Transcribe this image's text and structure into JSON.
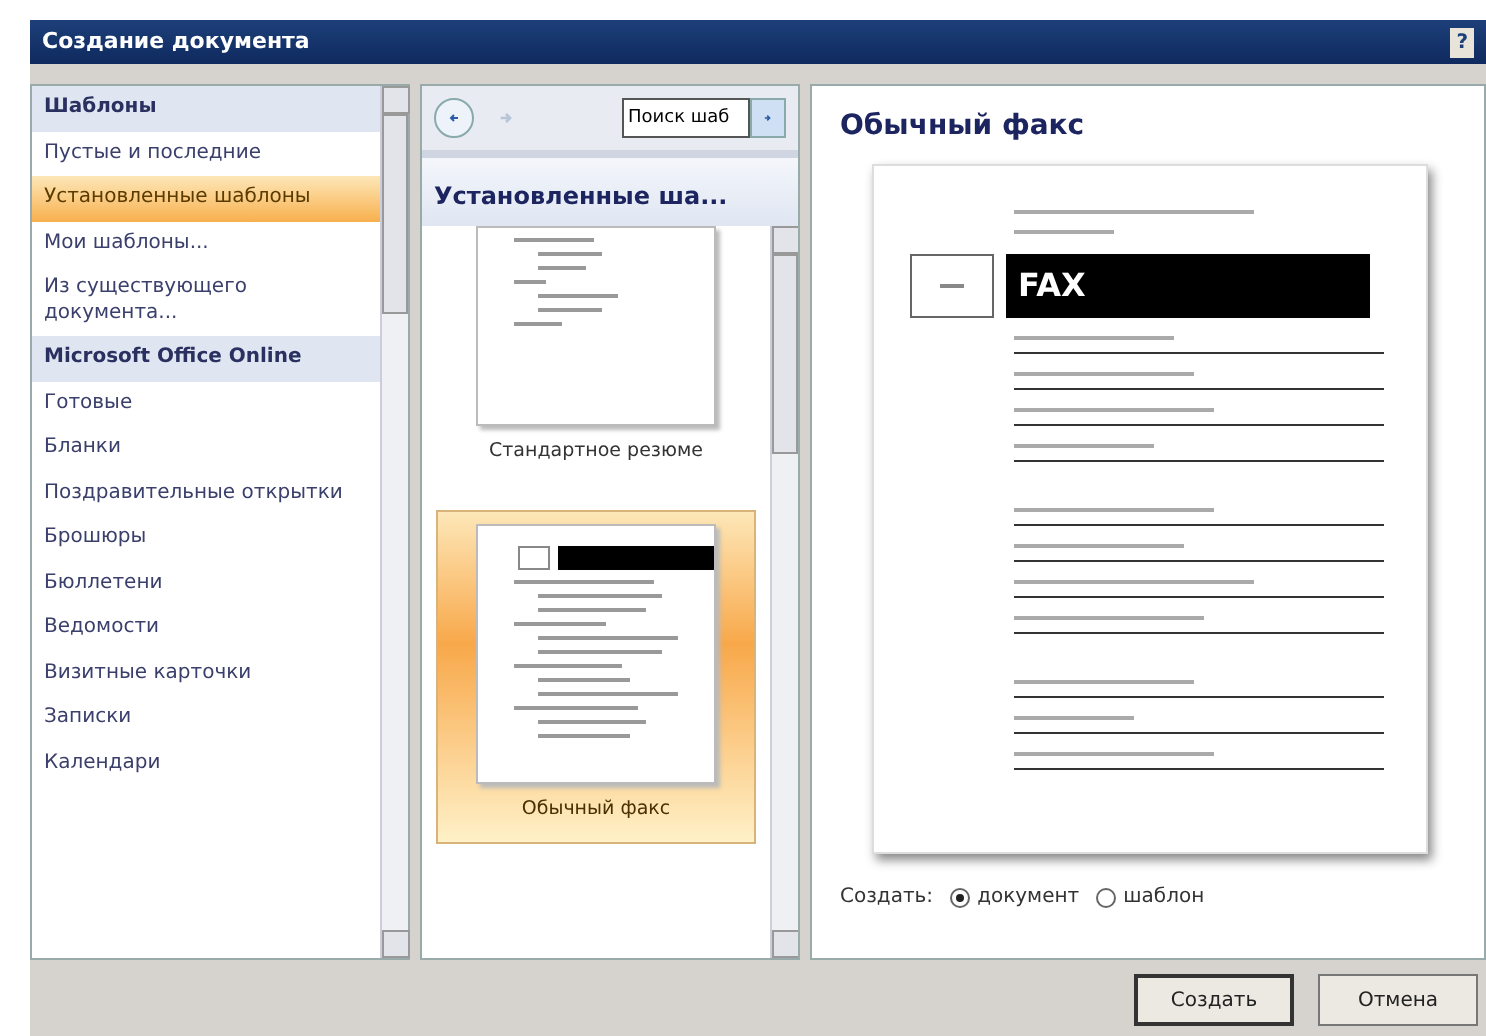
{
  "window": {
    "title": "Создание документа",
    "help": "?"
  },
  "sidebar": {
    "items": [
      {
        "kind": "header",
        "label": "Шаблоны",
        "selected": false
      },
      {
        "kind": "item",
        "label": "Пустые и последние",
        "selected": false
      },
      {
        "kind": "item",
        "label": "Установленные шаблоны",
        "selected": true
      },
      {
        "kind": "item",
        "label": "Мои шаблоны...",
        "selected": false
      },
      {
        "kind": "item",
        "label": "Из существующего документа...",
        "selected": false
      },
      {
        "kind": "header",
        "label": "Microsoft Office Online",
        "selected": false
      },
      {
        "kind": "item",
        "label": "Готовые",
        "selected": false
      },
      {
        "kind": "item",
        "label": "Бланки",
        "selected": false
      },
      {
        "kind": "item",
        "label": "Поздравительные открытки",
        "selected": false
      },
      {
        "kind": "item",
        "label": "Брошюры",
        "selected": false
      },
      {
        "kind": "item",
        "label": "Бюллетени",
        "selected": false
      },
      {
        "kind": "item",
        "label": "Ведомости",
        "selected": false
      },
      {
        "kind": "item",
        "label": "Визитные карточки",
        "selected": false
      },
      {
        "kind": "item",
        "label": "Записки",
        "selected": false
      },
      {
        "kind": "item",
        "label": "Календари",
        "selected": false
      }
    ]
  },
  "gallery": {
    "search": {
      "value": "Поиск шаб"
    },
    "heading": "Установленные ша...",
    "templates": [
      {
        "kind": "resume",
        "label": "Стандартное резюме",
        "selected": false
      },
      {
        "kind": "fax",
        "label": "Обычный факс",
        "selected": true
      }
    ]
  },
  "preview": {
    "title": "Обычный факс",
    "heading": "FAX",
    "create_as": {
      "label": "Создать:",
      "options": [
        {
          "label": "документ",
          "selected": true
        },
        {
          "label": "шаблон",
          "selected": false
        }
      ]
    }
  },
  "buttons": [
    "Создать",
    "Отмена"
  ]
}
